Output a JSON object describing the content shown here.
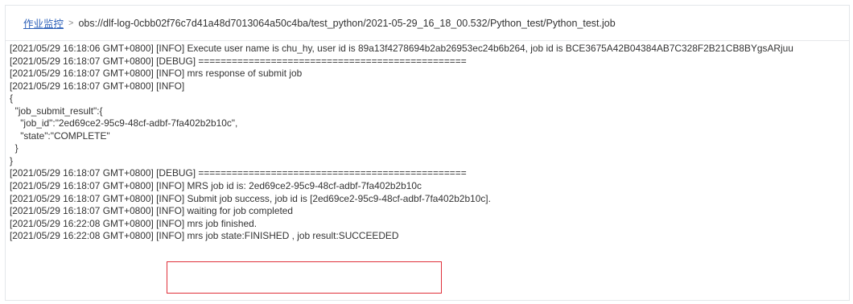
{
  "breadcrumb": {
    "link_label": "作业监控",
    "separator": ">",
    "path": "obs://dlf-log-0cbb02f76c7d41a48d7013064a50c4ba/test_python/2021-05-29_16_18_00.532/Python_test/Python_test.job"
  },
  "log": {
    "lines": [
      "[2021/05/29 16:18:06 GMT+0800] [INFO] Execute user name is chu_hy, user id is 89a13f4278694b2ab26953ec24b6b264, job id is BCE3675A42B04384AB7C328F2B21CB8BYgsARjuu",
      "[2021/05/29 16:18:07 GMT+0800] [DEBUG] ================================================",
      "[2021/05/29 16:18:07 GMT+0800] [INFO] mrs response of submit job",
      "[2021/05/29 16:18:07 GMT+0800] [INFO]",
      "{",
      "  \"job_submit_result\":{",
      "    \"job_id\":\"2ed69ce2-95c9-48cf-adbf-7fa402b2b10c\",",
      "    \"state\":\"COMPLETE\"",
      "  }",
      "}",
      "[2021/05/29 16:18:07 GMT+0800] [DEBUG] ================================================",
      "[2021/05/29 16:18:07 GMT+0800] [INFO] MRS job id is: 2ed69ce2-95c9-48cf-adbf-7fa402b2b10c",
      "[2021/05/29 16:18:07 GMT+0800] [INFO] Submit job success, job id is [2ed69ce2-95c9-48cf-adbf-7fa402b2b10c].",
      "[2021/05/29 16:18:07 GMT+0800] [INFO] waiting for job completed",
      "[2021/05/29 16:22:08 GMT+0800] [INFO] mrs job finished.",
      "[2021/05/29 16:22:08 GMT+0800] [INFO] mrs job state:FINISHED , job result:SUCCEEDED"
    ]
  },
  "colors": {
    "link": "#2b5fb8",
    "highlight_border": "#e0303a",
    "text": "#333333"
  }
}
